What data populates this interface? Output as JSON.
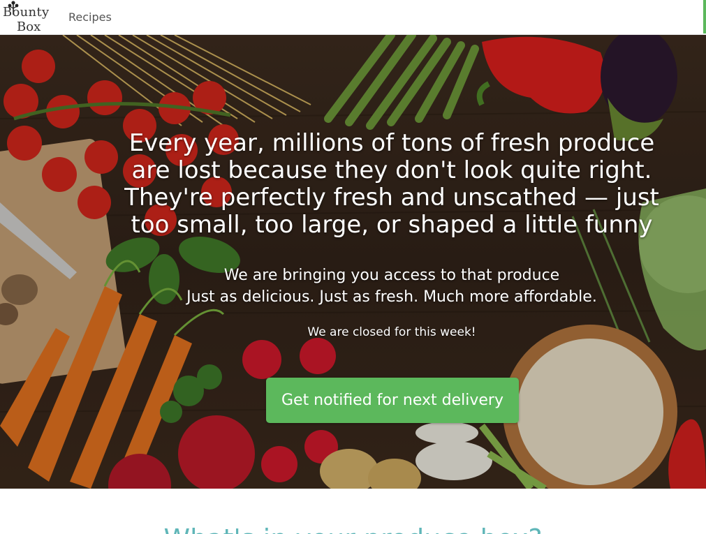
{
  "nav": {
    "logo_line1": "Bounty",
    "logo_line2": "Box",
    "links": [
      {
        "label": "Recipes"
      }
    ]
  },
  "hero": {
    "headline_lines": [
      "Every year, millions of tons of fresh produce",
      "are lost because they don't look quite right.",
      "They're perfectly fresh and unscathed — just",
      "too small, too large, or shaped a little funny"
    ],
    "sub_lines": [
      "We are bringing you access to that produce",
      "Just as delicious. Just as fresh. Much more affordable."
    ],
    "closed_notice": "We are closed for this week!",
    "cta_label": "Get notified for next delivery"
  },
  "section": {
    "heading_partial": "What's in your produce box?"
  },
  "colors": {
    "accent_green": "#5cb85c",
    "teal_heading": "#5fb6b8"
  }
}
